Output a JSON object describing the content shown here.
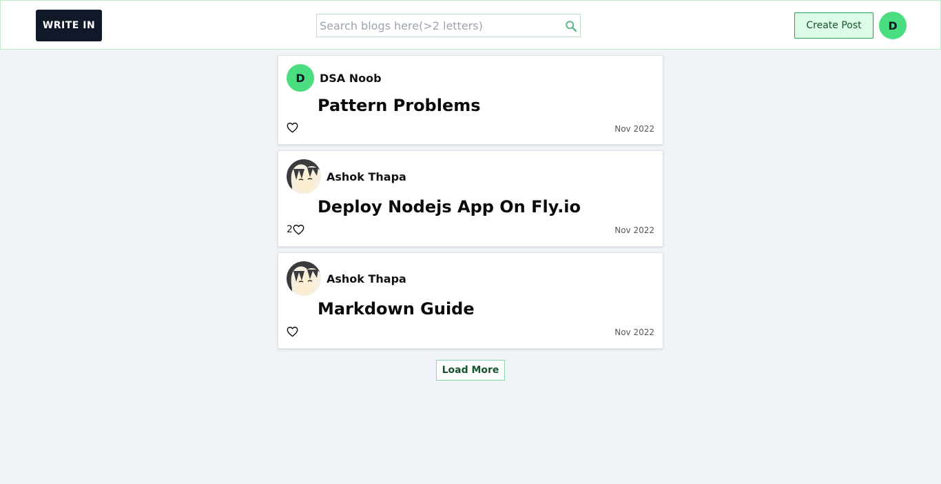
{
  "header": {
    "logo_text": "WRITE IN",
    "search_placeholder": "Search blogs here(>2 letters)",
    "search_value": "",
    "create_post_label": "Create Post",
    "user_initial": "D"
  },
  "posts": [
    {
      "author": "DSA Noob",
      "avatar_initial": "D",
      "title": "Pattern Problems",
      "likes": "",
      "date": "Nov 2022"
    },
    {
      "author": "Ashok Thapa",
      "avatar_initial": "",
      "title": "Deploy Nodejs App On Fly.io",
      "likes": "2",
      "date": "Nov 2022"
    },
    {
      "author": "Ashok Thapa",
      "avatar_initial": "",
      "title": "Markdown Guide",
      "likes": "",
      "date": "Nov 2022"
    }
  ],
  "load_more_label": "Load More",
  "icons": {
    "search": "search-icon",
    "like": "heart-icon",
    "avatar_photo": "anime-avatar-image"
  },
  "colors": {
    "accent_green": "#4ade80",
    "logo_bg": "#111827",
    "page_bg": "#f0f4f8"
  }
}
